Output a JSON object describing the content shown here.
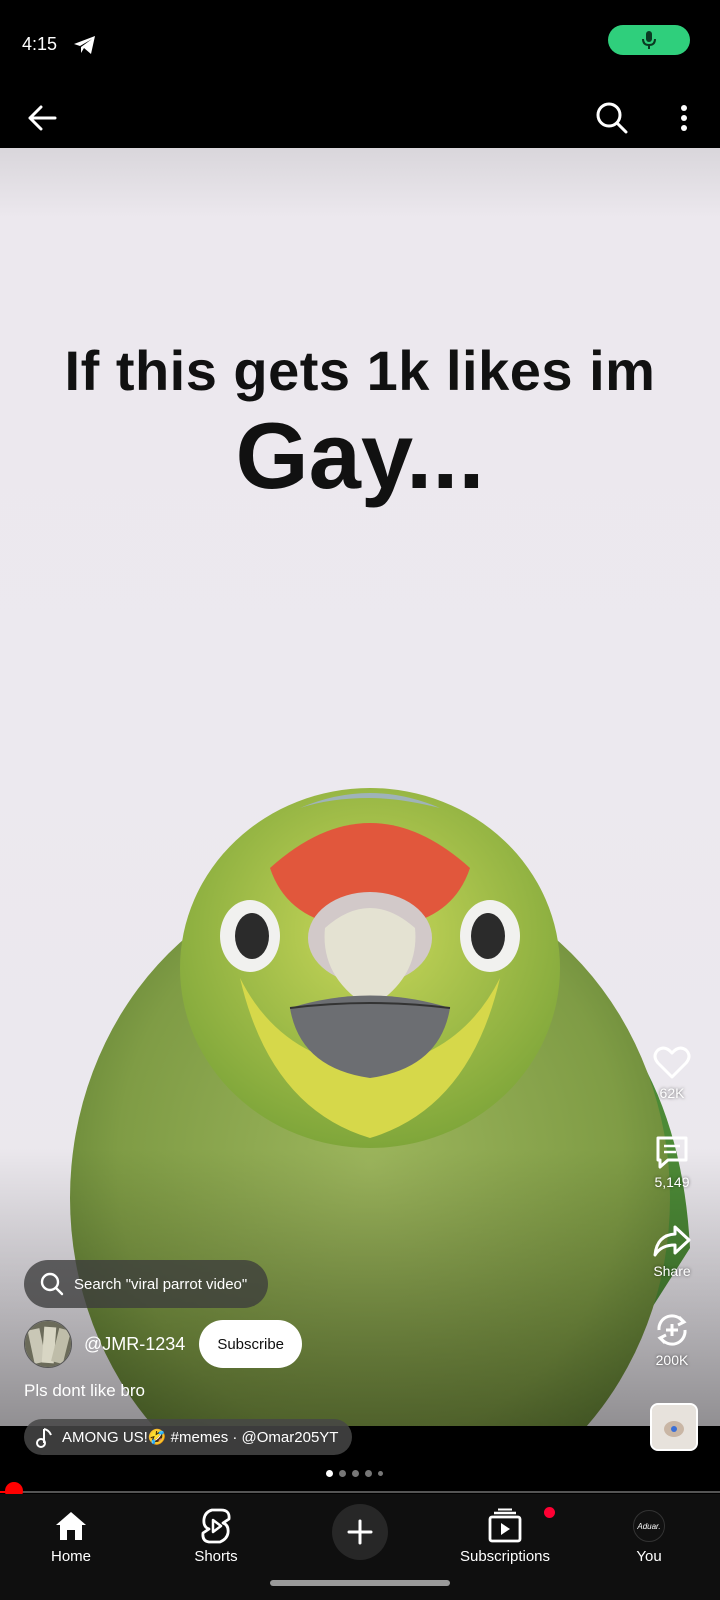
{
  "status_bar": {
    "time": "4:15"
  },
  "video": {
    "caption_line1": "If this gets 1k likes im",
    "caption_line2": "Gay..."
  },
  "actions": {
    "likes": "62K",
    "comments": "5,149",
    "share_label": "Share",
    "remix": "200K"
  },
  "search_suggestion": "Search \"viral parrot video\"",
  "channel": {
    "handle": "@JMR-1234",
    "subscribe_label": "Subscribe"
  },
  "title": "Pls dont like bro",
  "music": "AMONG US!🤣 #memes · @Omar205YT",
  "pager": {
    "count": 5,
    "active": 0
  },
  "playback": {
    "progress": 0.02
  },
  "nav": {
    "home": "Home",
    "shorts": "Shorts",
    "subscriptions": "Subscriptions",
    "you": "You",
    "you_avatar_text": "Aduar."
  },
  "colors": {
    "accent": "#ff0000",
    "mic_pill": "#2fcf7c"
  }
}
